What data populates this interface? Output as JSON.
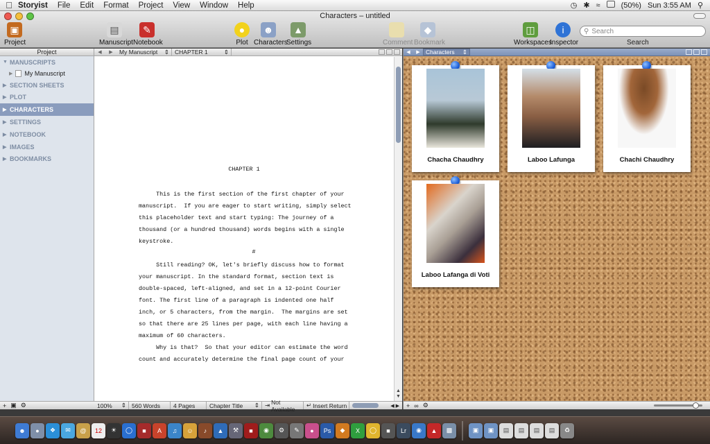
{
  "menubar": {
    "app_name": "Storyist",
    "menus": [
      "File",
      "Edit",
      "Format",
      "Project",
      "View",
      "Window",
      "Help"
    ],
    "battery": "(50%)",
    "clock": "Sun 3:55 AM"
  },
  "window": {
    "title": "Characters – untitled"
  },
  "toolbar": {
    "project": "Project",
    "manuscript": "Manuscript",
    "notebook": "Notebook",
    "plot": "Plot",
    "characters": "Characters",
    "settings": "Settings",
    "comment": "Comment",
    "bookmark": "Bookmark",
    "workspaces": "Workspaces",
    "inspector": "Inspector",
    "search_placeholder": "Search",
    "search_label": "Search"
  },
  "sidebar": {
    "header": "Project",
    "manuscripts": "MANUSCRIPTS",
    "my_manuscript": "My Manuscript",
    "section_sheets": "SECTION SHEETS",
    "plot": "PLOT",
    "characters": "CHARACTERS",
    "settings": "SETTINGS",
    "notebook": "NOTEBOOK",
    "images": "IMAGES",
    "bookmarks": "BOOKMARKS"
  },
  "editor": {
    "doc_popup": "My Manuscript",
    "section_popup": "CHAPTER 1",
    "chapter_heading": "CHAPTER 1",
    "para1": "     This is the first section of the first chapter of your\nmanuscript.  If you are eager to start writing, simply select\nthis placeholder text and start typing: The journey of a\nthousand (or a hundred thousand) words begins with a single\nkeystroke.",
    "separator": "#",
    "para2": "     Still reading? OK, let's briefly discuss how to format\nyour manuscript. In the standard format, section text is\ndouble-spaced, left-aligned, and set in a 12-point Courier\nfont. The first line of a paragraph is indented one half\ninch, or 5 characters, from the margin.  The margins are set\nso that there are 25 lines per page, with each line having a\nmaximum of 60 characters.\n     Why is that?  So that your editor can estimate the word\ncount and accurately determine the final page count of your",
    "status": {
      "zoom": "100%",
      "words": "560 Words",
      "pages": "4 Pages",
      "style": "Chapter Title",
      "availability": "Not Available",
      "insert_return": "Insert Return"
    }
  },
  "corkboard": {
    "header": "Characters",
    "cards": [
      {
        "name": "Chacha Chaudhry"
      },
      {
        "name": "Laboo Lafunga"
      },
      {
        "name": "Chachi Chaudhry"
      },
      {
        "name": "Laboo Lafanga di Voti"
      }
    ]
  },
  "dock": {
    "calendar_day": "12"
  }
}
